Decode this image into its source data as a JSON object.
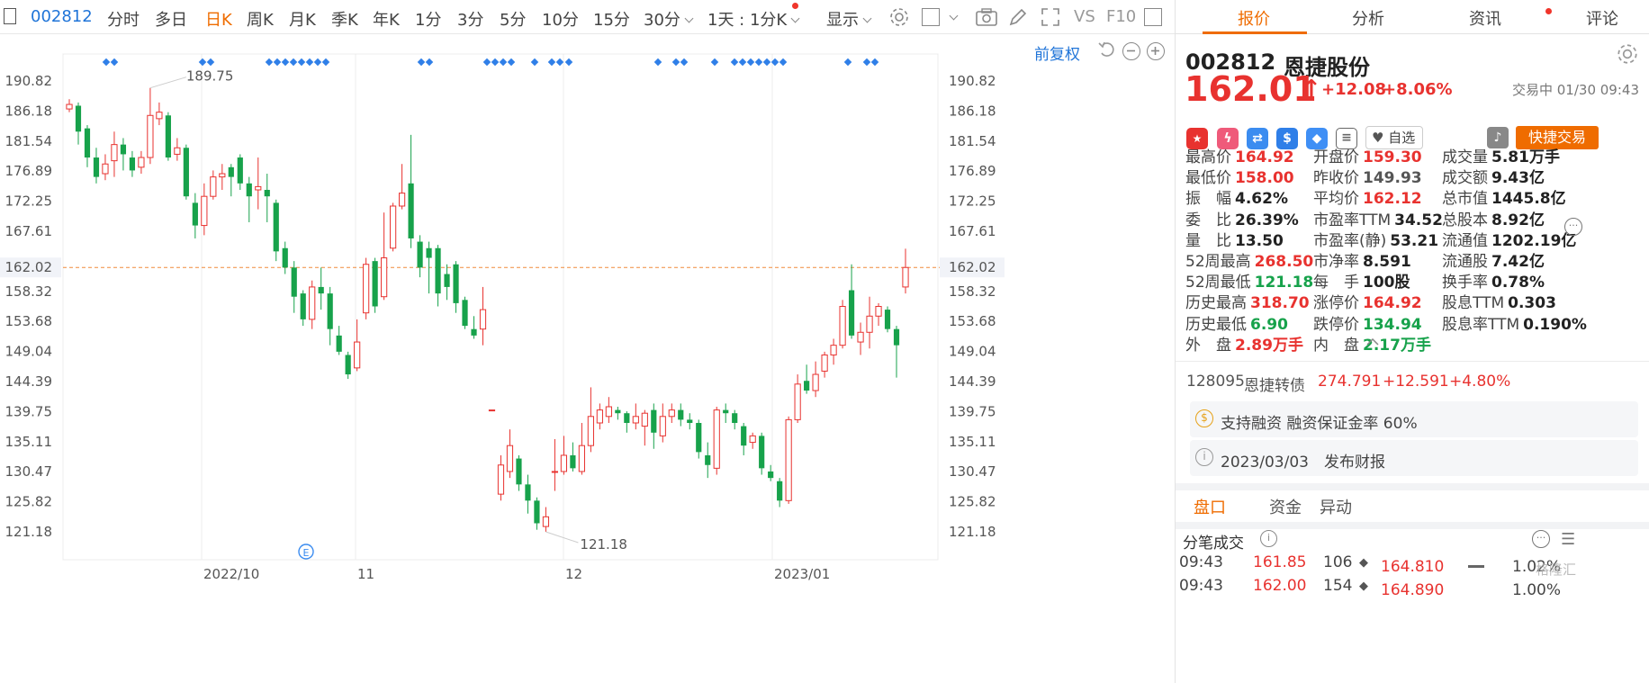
{
  "toolbar": {
    "stock_code": "002812",
    "periods": [
      "分时",
      "多日",
      "日K",
      "周K",
      "月K",
      "季K",
      "年K",
      "1分",
      "3分",
      "5分",
      "10分",
      "15分",
      "30分"
    ],
    "active_period": "日K",
    "interval_label": "1天 : 1分K",
    "display_label": "显示",
    "vs_label": "VS",
    "f10_label": "F10"
  },
  "chart": {
    "adjust_label": "前复权",
    "y_ticks": [
      "190.82",
      "186.18",
      "181.54",
      "176.89",
      "172.25",
      "167.61",
      "162.02",
      "158.32",
      "153.68",
      "149.04",
      "144.39",
      "139.75",
      "135.11",
      "130.47",
      "125.82",
      "121.18"
    ],
    "x_ticks": [
      "2022/10",
      "11",
      "12",
      "2023/01"
    ],
    "current_price_label": "162.02",
    "max_label": "189.75",
    "min_label": "121.18",
    "event_marker": "E"
  },
  "chart_data": {
    "type": "candlestick",
    "title": "",
    "ylim": [
      116.5,
      195.5
    ],
    "up_color": "#e8322f",
    "down_color": "#17a24b",
    "current_price": 162.02,
    "max_price": 189.75,
    "min_price": 121.18,
    "x_labels": [
      "2022/10",
      "11",
      "12",
      "2023/01"
    ],
    "candles": [
      [
        186.5,
        187.2,
        188.0,
        186.0
      ],
      [
        187.0,
        183.0,
        187.5,
        181.0
      ],
      [
        183.5,
        179.0,
        184.0,
        177.5
      ],
      [
        179.0,
        176.0,
        180.5,
        175.0
      ],
      [
        176.5,
        178.0,
        179.5,
        175.5
      ],
      [
        178.5,
        181.0,
        183.0,
        176.0
      ],
      [
        181.0,
        179.5,
        182.0,
        177.0
      ],
      [
        179.0,
        177.0,
        180.0,
        176.0
      ],
      [
        177.5,
        179.0,
        180.0,
        176.5
      ],
      [
        179.0,
        185.5,
        189.75,
        178.0
      ],
      [
        185.0,
        186.0,
        187.5,
        184.0
      ],
      [
        185.5,
        179.0,
        186.0,
        178.5
      ],
      [
        179.5,
        180.5,
        182.0,
        178.5
      ],
      [
        180.5,
        173.0,
        181.0,
        172.5
      ],
      [
        172.0,
        168.5,
        173.5,
        166.5
      ],
      [
        168.5,
        173.0,
        175.0,
        167.0
      ],
      [
        173.0,
        176.0,
        177.0,
        172.5
      ],
      [
        176.0,
        176.5,
        178.0,
        174.0
      ],
      [
        177.5,
        176.0,
        178.0,
        173.0
      ],
      [
        179.0,
        175.0,
        179.5,
        174.0
      ],
      [
        175.0,
        173.0,
        176.0,
        169.0
      ],
      [
        174.0,
        174.5,
        179.0,
        171.0
      ],
      [
        174.0,
        173.0,
        176.5,
        169.0
      ],
      [
        172.0,
        164.5,
        172.5,
        163.0
      ],
      [
        165.0,
        162.0,
        166.0,
        161.0
      ],
      [
        162.0,
        157.5,
        163.0,
        155.0
      ],
      [
        158.0,
        154.0,
        158.5,
        153.0
      ],
      [
        154.0,
        159.0,
        160.0,
        152.5
      ],
      [
        159.0,
        158.0,
        162.0,
        155.5
      ],
      [
        158.0,
        152.5,
        159.0,
        150.0
      ],
      [
        151.5,
        149.0,
        153.0,
        148.5
      ],
      [
        148.5,
        145.5,
        149.0,
        144.8
      ],
      [
        146.5,
        150.5,
        154.0,
        146.0
      ],
      [
        155.0,
        162.5,
        163.5,
        154.0
      ],
      [
        163.0,
        156.0,
        163.5,
        155.0
      ],
      [
        157.5,
        163.5,
        170.5,
        157.0
      ],
      [
        165.0,
        171.5,
        172.0,
        164.5
      ],
      [
        171.5,
        173.5,
        178.0,
        171.0
      ],
      [
        175.0,
        166.5,
        182.5,
        165.0
      ],
      [
        166.0,
        162.0,
        167.0,
        160.5
      ],
      [
        165.0,
        163.5,
        166.0,
        158.0
      ],
      [
        165.0,
        158.0,
        165.5,
        156.0
      ],
      [
        161.0,
        159.0,
        162.5,
        157.0
      ],
      [
        162.5,
        156.5,
        163.0,
        155.0
      ],
      [
        157.0,
        153.0,
        157.5,
        152.5
      ],
      [
        152.5,
        151.5,
        154.5,
        151.0
      ],
      [
        152.5,
        155.5,
        159.0,
        150.0
      ],
      [
        140.0,
        140.0,
        140.0,
        140.0
      ],
      [
        127.0,
        131.5,
        133.0,
        126.0
      ],
      [
        130.5,
        134.5,
        137.0,
        129.5
      ],
      [
        132.5,
        128.5,
        133.0,
        127.5
      ],
      [
        128.5,
        126.0,
        130.0,
        124.0
      ],
      [
        126.0,
        122.5,
        126.5,
        121.5
      ],
      [
        122.0,
        123.5,
        125.0,
        121.18
      ],
      [
        130.5,
        130.5,
        135.5,
        127.5
      ],
      [
        130.5,
        133.0,
        136.0,
        130.0
      ],
      [
        133.0,
        131.0,
        135.0,
        130.5
      ],
      [
        130.5,
        134.5,
        138.0,
        130.0
      ],
      [
        134.5,
        139.0,
        143.5,
        133.5
      ],
      [
        138.0,
        140.0,
        141.0,
        137.0
      ],
      [
        139.0,
        140.5,
        142.0,
        138.0
      ],
      [
        140.0,
        139.5,
        140.5,
        138.5
      ],
      [
        139.5,
        138.0,
        139.8,
        136.5
      ],
      [
        138.0,
        139.0,
        141.0,
        137.0
      ],
      [
        137.5,
        139.5,
        140.0,
        134.5
      ],
      [
        140.0,
        136.5,
        141.0,
        134.0
      ],
      [
        136.0,
        139.0,
        141.0,
        135.0
      ],
      [
        139.0,
        140.0,
        141.0,
        138.0
      ],
      [
        140.0,
        138.5,
        141.0,
        137.5
      ],
      [
        138.5,
        138.0,
        139.5,
        137.0
      ],
      [
        138.0,
        133.5,
        138.5,
        132.5
      ],
      [
        133.0,
        131.5,
        135.0,
        129.5
      ],
      [
        131.0,
        140.0,
        140.5,
        130.0
      ],
      [
        140.0,
        139.5,
        141.0,
        138.0
      ],
      [
        139.5,
        138.0,
        140.0,
        137.0
      ],
      [
        137.5,
        134.5,
        138.0,
        133.0
      ],
      [
        135.0,
        136.0,
        136.5,
        134.0
      ],
      [
        136.0,
        131.0,
        136.5,
        130.0
      ],
      [
        130.5,
        129.5,
        131.5,
        129.0
      ],
      [
        129.0,
        126.0,
        129.5,
        125.0
      ],
      [
        126.0,
        138.5,
        139.0,
        125.5
      ],
      [
        138.5,
        144.0,
        145.5,
        138.0
      ],
      [
        144.5,
        143.0,
        147.0,
        142.5
      ],
      [
        143.0,
        145.5,
        147.5,
        142.0
      ],
      [
        146.0,
        148.5,
        149.0,
        145.0
      ],
      [
        148.5,
        150.0,
        151.0,
        147.0
      ],
      [
        150.0,
        156.0,
        157.0,
        149.5
      ],
      [
        158.5,
        151.5,
        162.5,
        151.0
      ],
      [
        150.5,
        152.0,
        153.5,
        148.5
      ],
      [
        152.0,
        154.5,
        157.5,
        149.5
      ],
      [
        154.5,
        156.0,
        156.5,
        153.0
      ],
      [
        155.5,
        152.5,
        156.0,
        152.0
      ],
      [
        152.5,
        150.0,
        153.0,
        145.0
      ],
      [
        159.0,
        162.01,
        164.92,
        158.0
      ]
    ]
  },
  "tabs": [
    "报价",
    "分析",
    "资讯",
    "评论"
  ],
  "stock": {
    "code": "002812",
    "name": "恩捷股份",
    "price": "162.01",
    "change": "+12.08",
    "change_pct": "+8.06%",
    "status": "交易中 01/30 09:43",
    "watchlist_label": "自选",
    "quick_trade_label": "快捷交易"
  },
  "quote_rows": [
    [
      {
        "label": "最高价",
        "value": "164.92",
        "tone": "red"
      },
      {
        "label": "开盘价",
        "value": "159.30",
        "tone": "red"
      },
      {
        "label": "成交量",
        "value": "5.81万手",
        "tone": "dark"
      }
    ],
    [
      {
        "label": "最低价",
        "value": "158.00",
        "tone": "red"
      },
      {
        "label": "昨收价",
        "value": "149.93",
        "tone": "gray"
      },
      {
        "label": "成交额",
        "value": "9.43亿",
        "tone": "dark"
      }
    ],
    [
      {
        "label": "振　幅",
        "value": "4.62%",
        "tone": "dark"
      },
      {
        "label": "平均价",
        "value": "162.12",
        "tone": "red"
      },
      {
        "label": "总市值",
        "value": "1445.8亿",
        "tone": "dark"
      }
    ],
    [
      {
        "label": "委　比",
        "value": "26.39%",
        "tone": "dark"
      },
      {
        "label": "市盈率TTM",
        "value": "34.52",
        "tone": "dark"
      },
      {
        "label": "总股本",
        "value": "8.92亿",
        "tone": "dark"
      }
    ],
    [
      {
        "label": "量　比",
        "value": "13.50",
        "tone": "dark"
      },
      {
        "label": "市盈率(静)",
        "value": "53.21",
        "tone": "dark"
      },
      {
        "label": "流通值",
        "value": "1202.19亿",
        "tone": "dark"
      }
    ],
    [
      {
        "label": "52周最高",
        "value": "268.50",
        "tone": "red"
      },
      {
        "label": "市净率",
        "value": "8.591",
        "tone": "dark"
      },
      {
        "label": "流通股",
        "value": "7.42亿",
        "tone": "dark"
      }
    ],
    [
      {
        "label": "52周最低",
        "value": "121.18",
        "tone": "green"
      },
      {
        "label": "每　手",
        "value": "100股",
        "tone": "dark"
      },
      {
        "label": "换手率",
        "value": "0.78%",
        "tone": "dark"
      }
    ],
    [
      {
        "label": "历史最高",
        "value": "318.70",
        "tone": "red"
      },
      {
        "label": "涨停价",
        "value": "164.92",
        "tone": "red"
      },
      {
        "label": "股息TTM",
        "value": "0.303",
        "tone": "dark"
      }
    ],
    [
      {
        "label": "历史最低",
        "value": "6.90",
        "tone": "green"
      },
      {
        "label": "跌停价",
        "value": "134.94",
        "tone": "green"
      },
      {
        "label": "股息率TTM",
        "value": "0.190%",
        "tone": "dark"
      }
    ],
    [
      {
        "label": "外　盘",
        "value": "2.89万手",
        "tone": "red"
      },
      {
        "label": "内　盘",
        "value": "2.17万手",
        "tone": "green"
      },
      {
        "label": "",
        "value": "",
        "tone": "dark"
      }
    ]
  ],
  "convertible": {
    "code": "128095",
    "name": "恩捷转债",
    "price": "274.791",
    "change": "+12.591",
    "change_pct": "+4.80%"
  },
  "margin_info": "支持融资 融资保证金率 60%",
  "report_info": "2023/03/03　发布财报",
  "sub_tabs": [
    "盘口",
    "资金",
    "异动"
  ],
  "ticks_header": "分笔成交",
  "ticks": [
    {
      "time": "09:43",
      "price": "161.85",
      "volume": "106",
      "flag": "◆"
    },
    {
      "time": "09:43",
      "price": "162.00",
      "volume": "154",
      "flag": "◆"
    }
  ],
  "depth": [
    {
      "price": "164.810",
      "pct": "1.02%"
    },
    {
      "price": "164.890",
      "pct": "1.00%"
    }
  ],
  "watermark": "格隆汇"
}
